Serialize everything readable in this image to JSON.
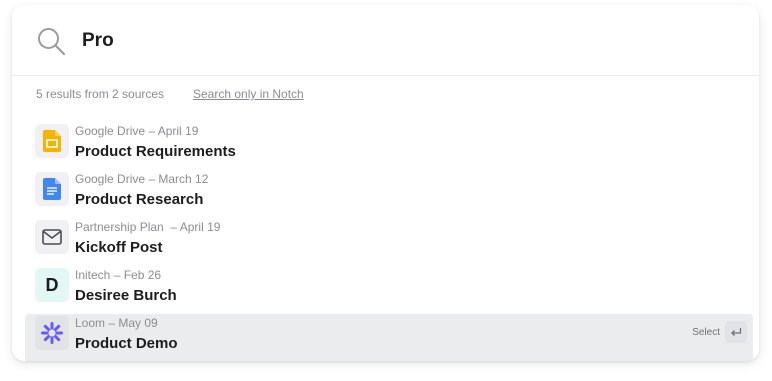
{
  "search": {
    "query": "Pro",
    "icon": "search-icon"
  },
  "meta": {
    "summary": "5 results from 2 sources",
    "filter_link": "Search only in Notch"
  },
  "results": [
    {
      "icon": "google-slides-icon",
      "subtitle": "Google Drive – April 19",
      "title": "Product Requirements"
    },
    {
      "icon": "google-docs-icon",
      "subtitle": "Google Drive – March 12",
      "title": "Product Research"
    },
    {
      "icon": "mail-icon",
      "subtitle": "Partnership Plan  – April 19",
      "title": "Kickoff Post"
    },
    {
      "icon": "avatar-letter",
      "letter": "D",
      "subtitle": "Initech – Feb 26",
      "title": "Desiree Burch"
    },
    {
      "icon": "loom-icon",
      "subtitle": "Loom – May 09",
      "title": "Product Demo",
      "selected": true
    }
  ],
  "select_hint": {
    "label": "Select",
    "key_icon": "enter-key-icon"
  },
  "colors": {
    "slides_yellow": "#f4b400",
    "docs_blue": "#4285f4",
    "loom_purple": "#625df5",
    "selected_bg": "#ebeced"
  }
}
